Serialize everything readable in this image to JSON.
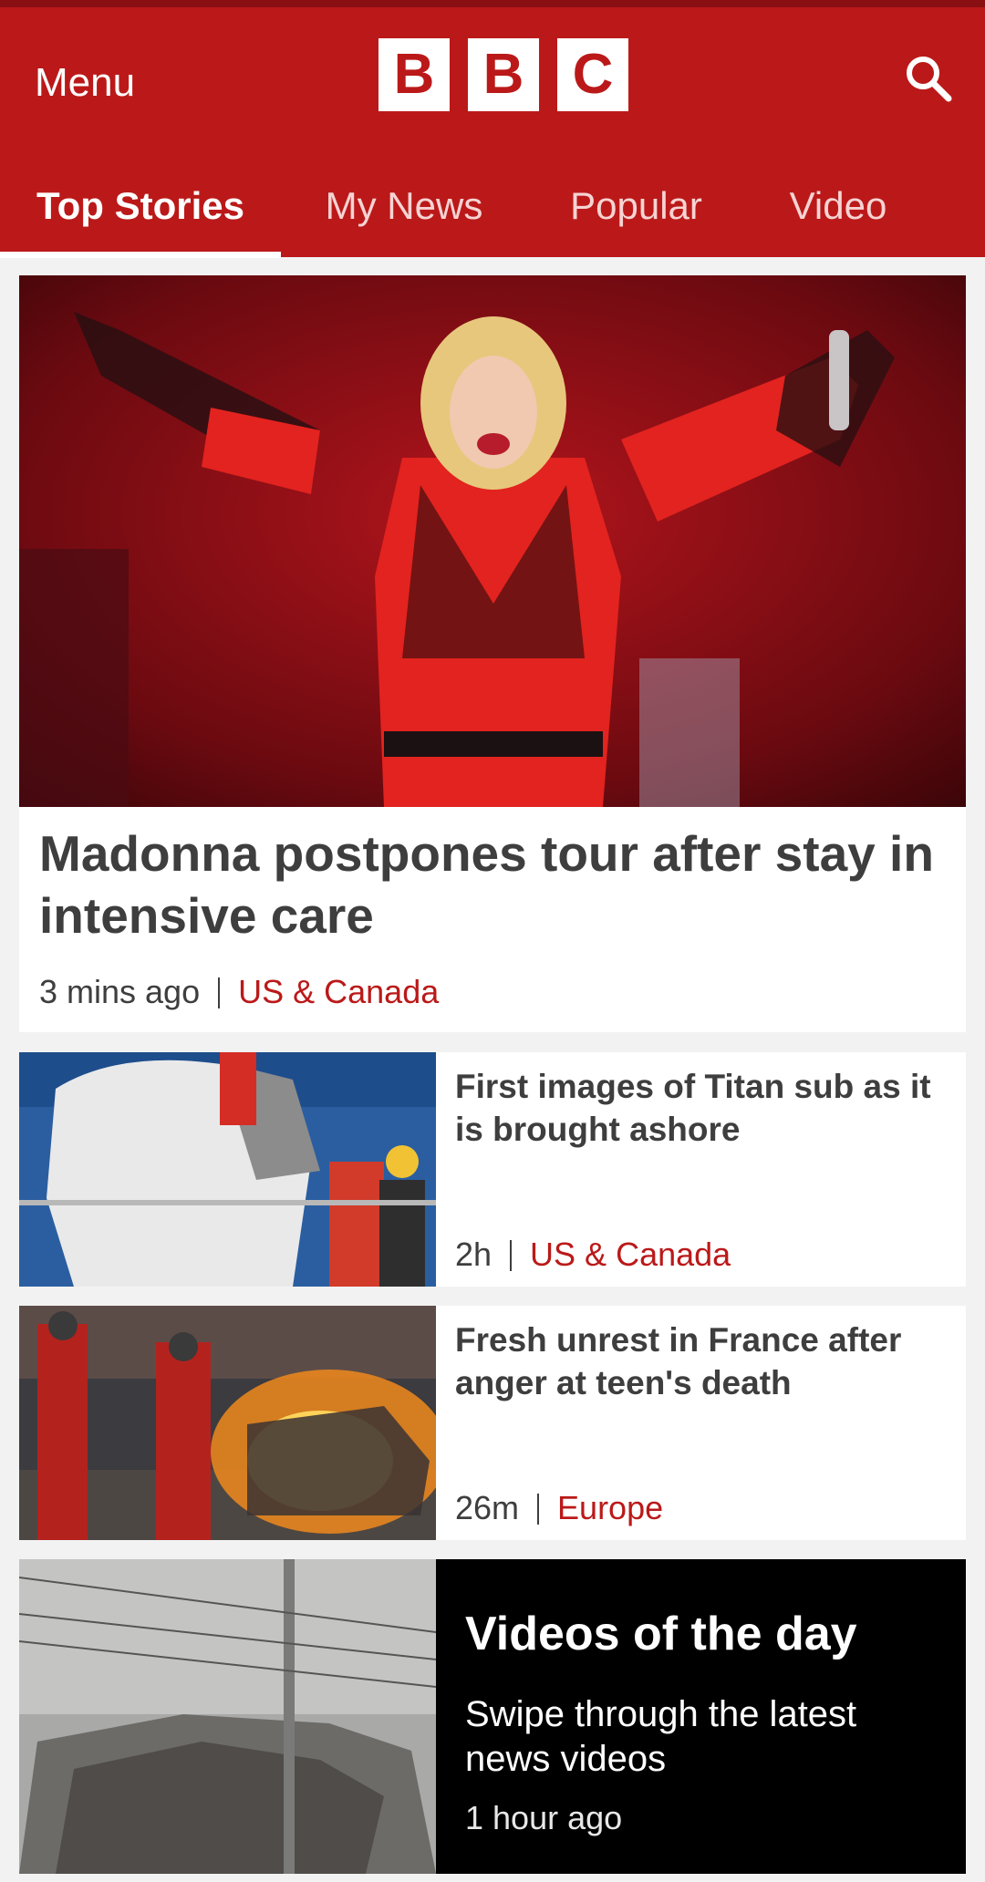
{
  "header": {
    "menu_label": "Menu",
    "logo_letters": [
      "B",
      "B",
      "C"
    ],
    "search_icon": "search-icon",
    "brand_color": "#bb1919"
  },
  "tabs": [
    {
      "label": "Top Stories",
      "active": true
    },
    {
      "label": "My News",
      "active": false
    },
    {
      "label": "Popular",
      "active": false
    },
    {
      "label": "Video",
      "active": false
    }
  ],
  "hero": {
    "title": "Madonna postpones tour after stay in intensive care",
    "time": "3 mins ago",
    "section": "US & Canada"
  },
  "stories": [
    {
      "title": "First images of Titan sub as it is brought ashore",
      "time": "2h",
      "section": "US & Canada"
    },
    {
      "title": "Fresh unrest in France after anger at teen's death",
      "time": "26m",
      "section": "Europe"
    }
  ],
  "videos_of_the_day": {
    "title": "Videos of the day",
    "subtitle": "Swipe through the latest news videos",
    "time": "1 hour ago"
  }
}
